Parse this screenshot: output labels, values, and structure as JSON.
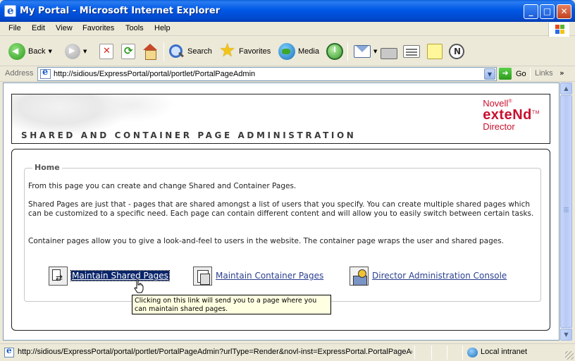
{
  "window": {
    "title": "My Portal - Microsoft Internet Explorer",
    "minimize": "_",
    "maximize": "□",
    "close": "✕"
  },
  "menu": [
    "File",
    "Edit",
    "View",
    "Favorites",
    "Tools",
    "Help"
  ],
  "toolbar": {
    "back": "Back",
    "search": "Search",
    "favorites": "Favorites",
    "media": "Media"
  },
  "address": {
    "label": "Address",
    "url": "http://sidious/ExpressPortal/portal/portlet/PortalPageAdmin",
    "go": "Go",
    "links": "Links"
  },
  "page": {
    "heading": "SHARED AND CONTAINER PAGE ADMINISTRATION",
    "logo": {
      "line1": "Novell",
      "line1_mark": "®",
      "line2": "exteNd",
      "line2_mark": "TM",
      "line3": "Director"
    },
    "section_title": "Home",
    "paragraphs": [
      "From this page you can create and change Shared and Container Pages.",
      "Shared Pages are just that - pages that are shared amongst a list of users that you specify. You can create multiple shared pages which can be customized to a specific need. Each page can contain different content and will allow you to easily switch between certain tasks.",
      "Container pages allow you to give a look-and-feel to users in the website. The container page wraps the user and shared pages."
    ],
    "links": {
      "shared": "Maintain Shared Pages",
      "container": "Maintain Container Pages",
      "console": "Director Administration Console"
    },
    "tooltip": "Clicking on this link will send you to a page where you can maintain shared pages."
  },
  "status": {
    "text": "http://sidious/ExpressPortal/portal/portlet/PortalPageAdmin?urlType=Render&novl-inst=ExpressPortal.PortalPageAc",
    "zone": "Local intranet"
  }
}
